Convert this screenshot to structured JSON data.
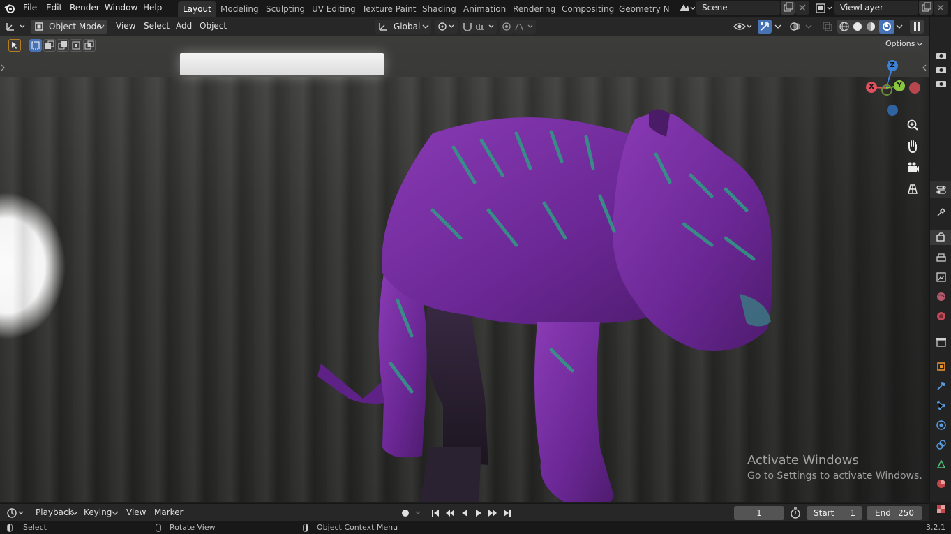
{
  "menubar": {
    "items": [
      "File",
      "Edit",
      "Render",
      "Window",
      "Help"
    ]
  },
  "workspaces": {
    "tabs": [
      "Layout",
      "Modeling",
      "Sculpting",
      "UV Editing",
      "Texture Paint",
      "Shading",
      "Animation",
      "Rendering",
      "Compositing",
      "Geometry Noc"
    ],
    "active": "Layout"
  },
  "scene": {
    "name": "Scene"
  },
  "view_layer": {
    "name": "ViewLayer"
  },
  "header": {
    "mode": "Object Mode",
    "menus": [
      "View",
      "Select",
      "Add",
      "Object"
    ],
    "orientation": "Global"
  },
  "viewport": {
    "options_label": "Options",
    "gizmo": {
      "x": "X",
      "y": "Y",
      "z": "Z"
    }
  },
  "watermark": {
    "title": "Activate Windows",
    "subtitle": "Go to Settings to activate Windows."
  },
  "timeline": {
    "menus": [
      "Playback",
      "Keying",
      "View",
      "Marker"
    ],
    "current_frame": "1",
    "start_label": "Start",
    "start_value": "1",
    "end_label": "End",
    "end_value": "250"
  },
  "statusbar": {
    "select": "Select",
    "rotate": "Rotate View",
    "context": "Object Context Menu",
    "version": "3.2.1"
  },
  "colors": {
    "accent": "#4772b3",
    "tiger_purple": "#7a2aa0",
    "tiger_stripe": "#2f9c84",
    "axis_x": "#e0505e",
    "axis_y": "#8bc53f",
    "axis_z": "#3b82d6"
  }
}
